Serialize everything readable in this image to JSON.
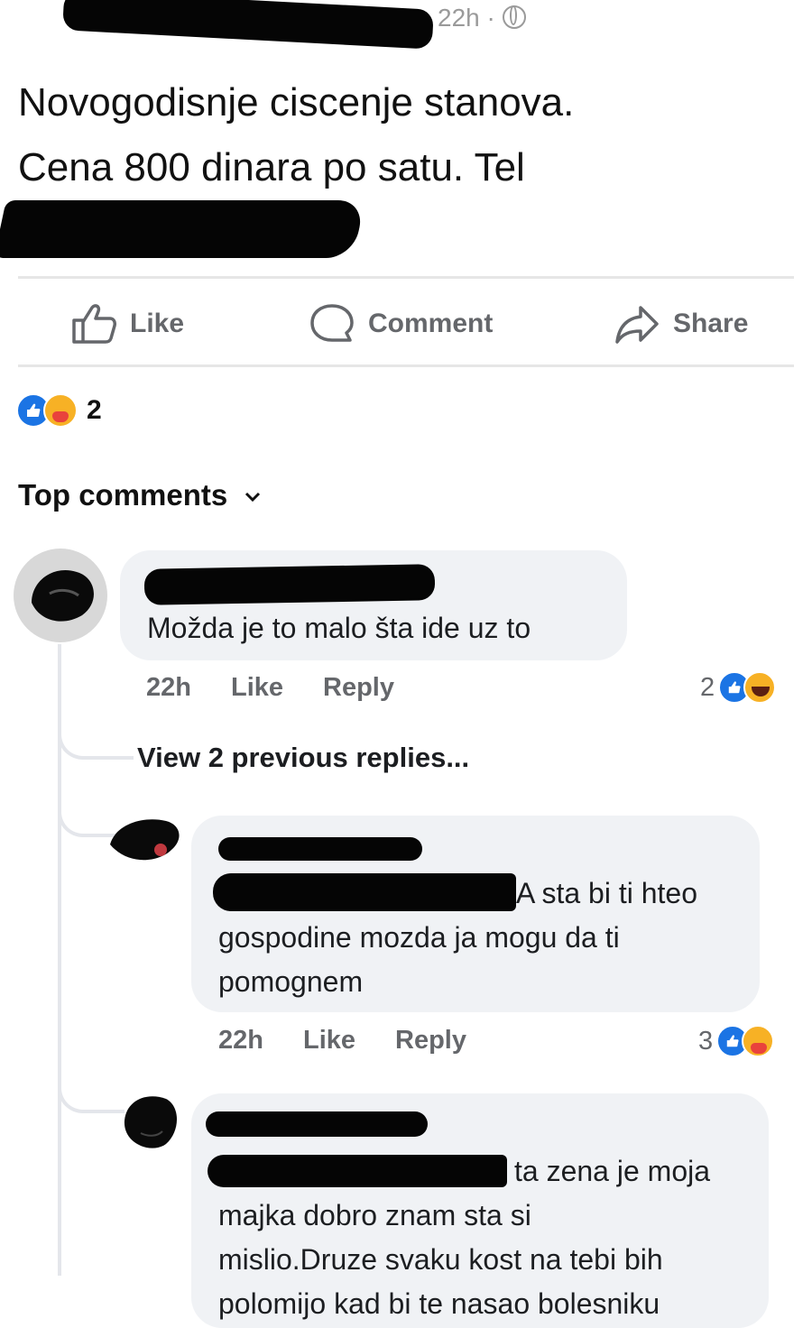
{
  "post": {
    "time": "22h ·",
    "text_line1": "Novogodisnje ciscenje stanova.",
    "text_line2": "Cena 800 dinara po satu. Tel"
  },
  "actions": {
    "like": "Like",
    "comment": "Comment",
    "share": "Share"
  },
  "reactions": {
    "count": "2",
    "icons": [
      "like-icon",
      "care-icon"
    ]
  },
  "top_comments": {
    "label": "Top comments"
  },
  "comments": [
    {
      "text": "Možda je to malo šta ide uz to",
      "time": "22h",
      "like": "Like",
      "reply": "Reply",
      "reaction_count": "2",
      "reaction_icons": [
        "like-icon",
        "haha-icon"
      ]
    }
  ],
  "view_previous": "View 2 previous replies...",
  "replies": [
    {
      "line1": "A sta bi ti hteo",
      "line2": "gospodine mozda ja mogu da ti",
      "line3": "pomognem",
      "time": "22h",
      "like": "Like",
      "reply": "Reply",
      "reaction_count": "3",
      "reaction_icons": [
        "like-icon",
        "care-icon"
      ]
    },
    {
      "line1": "ta zena je moja",
      "line2": "majka dobro znam sta si",
      "line3": "mislio.Druze svaku kost na tebi bih",
      "line4": "polomijo kad bi te nasao bolesniku"
    }
  ],
  "colors": {
    "like_blue": "#1b74e4",
    "bubble_gray": "#f0f2f5",
    "meta_gray": "#65676b",
    "redaction": "#050505"
  }
}
